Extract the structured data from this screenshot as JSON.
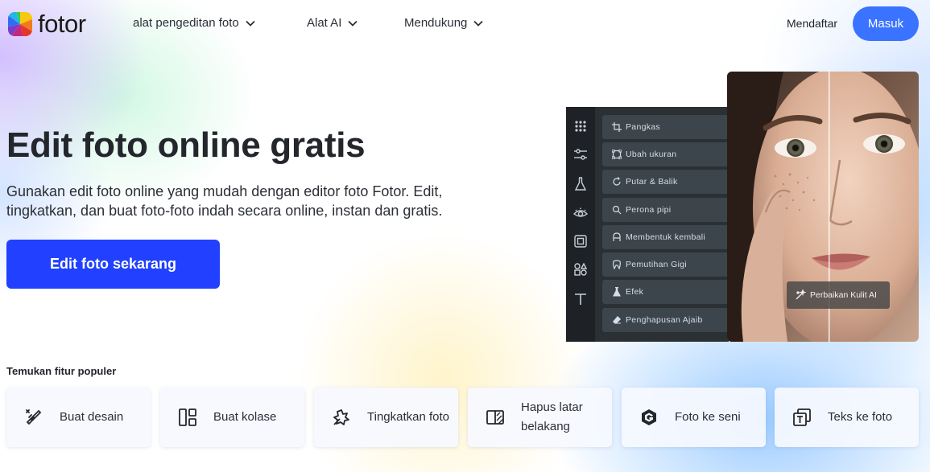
{
  "header": {
    "logo_text": "fotor",
    "nav": [
      {
        "label": "alat pengeditan foto"
      },
      {
        "label": "Alat AI"
      },
      {
        "label": "Mendukung"
      }
    ],
    "signup_label": "Mendaftar",
    "login_label": "Masuk"
  },
  "hero": {
    "title": "Edit foto online gratis",
    "description": "Gunakan edit foto online yang mudah dengan editor foto Fotor. Edit, tingkatkan, dan buat foto-foto indah secara online, instan dan gratis.",
    "cta_label": "Edit foto sekarang"
  },
  "editor_mock": {
    "tools": [
      {
        "label": "Pangkas",
        "icon": "crop-icon"
      },
      {
        "label": "Ubah ukuran",
        "icon": "resize-icon"
      },
      {
        "label": "Putar & Balik",
        "icon": "rotate-icon"
      },
      {
        "label": "Perona pipi",
        "icon": "blush-icon"
      },
      {
        "label": "Membentuk kembali",
        "icon": "reshape-icon"
      },
      {
        "label": "Pemutihan Gigi",
        "icon": "teeth-icon"
      },
      {
        "label": "Efek",
        "icon": "flask-icon"
      },
      {
        "label": "Penghapusan Ajaib",
        "icon": "eraser-icon"
      }
    ],
    "badge_label": "Perbaikan Kulit AI"
  },
  "features": {
    "title": "Temukan fitur populer",
    "cards": [
      {
        "label": "Buat desain",
        "icon": "design-icon"
      },
      {
        "label": "Buat kolase",
        "icon": "collage-icon"
      },
      {
        "label": "Tingkatkan foto",
        "icon": "enhance-icon"
      },
      {
        "label": "Hapus latar belakang",
        "icon": "remove-bg-icon"
      },
      {
        "label": "Foto ke seni",
        "icon": "photo-to-art-icon"
      },
      {
        "label": "Teks ke foto",
        "icon": "text-to-photo-icon"
      }
    ]
  },
  "colors": {
    "login_button": "#3a73ff",
    "cta_button": "#2140ff",
    "editor_panel": "#2b3035"
  }
}
